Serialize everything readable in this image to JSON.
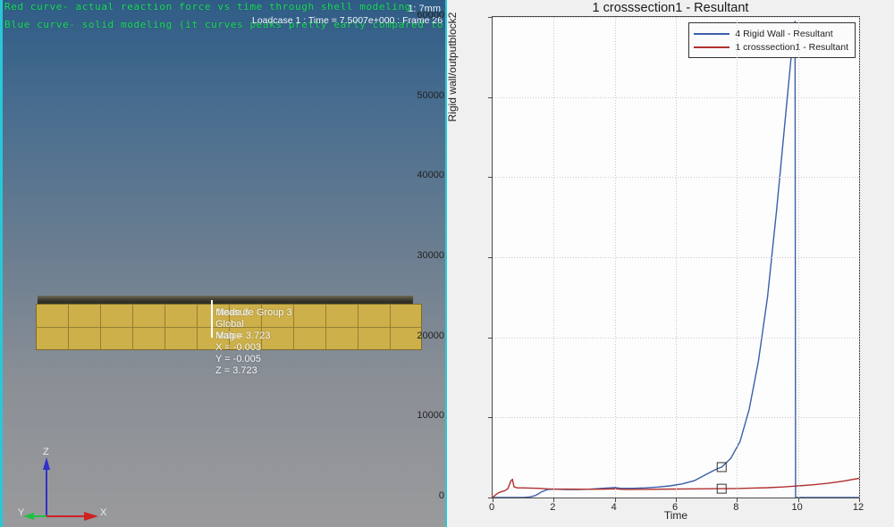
{
  "viewport": {
    "annotation_line1": "Red curve- actual reaction force vs time through shell modeling",
    "annotation_line2": "Blue curve- solid modeling (it curves peaks pretty early compared to the red curve which shouldn't happen)",
    "view_scale_label": "1: 7mm",
    "loadcase_status": "Loadcase 1 : Time = 7.5007e+000 : Frame 26",
    "measure": {
      "group_label": "Measure Group 3",
      "overlay_label": "Node 3",
      "frame_label": "Global",
      "mag_label": "Mag = 3.723",
      "mag_overlay": "Value",
      "x_label": "X = -0.003",
      "y_label": "Y = -0.005",
      "z_label": "Z = 3.723"
    },
    "triad": {
      "x_axis": "X",
      "y_axis": "Y",
      "z_axis": "Z"
    },
    "colors": {
      "annotation_green": "#19e05a",
      "border_cyan": "#28c8d8",
      "mesh_gold": "#cdb04a",
      "axis_x_red": "#d02020",
      "axis_y_green": "#20c040",
      "axis_z_blue": "#3030c8"
    },
    "mesh": {
      "columns": 12,
      "rows": 2
    }
  },
  "chart_data": {
    "type": "line",
    "title": "1 crosssection1 - Resultant",
    "xlabel": "Time",
    "ylabel": "Rigid wall/outputblock2",
    "xlim": [
      0,
      12
    ],
    "ylim": [
      0,
      60000
    ],
    "xticks": [
      0,
      2,
      4,
      6,
      8,
      10,
      12
    ],
    "xtick_labels": [
      "0",
      "2",
      "4",
      "6",
      "8",
      "10",
      "12"
    ],
    "yticks": [
      0,
      10000,
      20000,
      30000,
      40000,
      50000,
      60000
    ],
    "ytick_labels": [
      "0",
      "10000",
      "20000",
      "30000",
      "40000",
      "50000",
      "60000"
    ],
    "grid": true,
    "legend_position": "top-right",
    "series": [
      {
        "name": "4 Rigid Wall - Resultant",
        "color": "#3b5fa8",
        "marker_point": {
          "x": 7.5,
          "y": 3800
        },
        "x": [
          0,
          0.2,
          0.5,
          0.8,
          1.0,
          1.2,
          1.4,
          1.6,
          1.8,
          2.0,
          2.4,
          2.8,
          3.2,
          3.6,
          4.0,
          4.2,
          4.6,
          5.0,
          5.4,
          5.8,
          6.2,
          6.6,
          7.0,
          7.3,
          7.5,
          7.8,
          8.1,
          8.4,
          8.7,
          9.0,
          9.3,
          9.6,
          9.85,
          9.9,
          9.92,
          12.0
        ],
        "y": [
          0,
          0,
          0,
          0,
          0,
          60,
          240,
          700,
          1000,
          1050,
          1000,
          1000,
          1050,
          1150,
          1250,
          1150,
          1150,
          1200,
          1300,
          1450,
          1700,
          2100,
          2900,
          3500,
          3800,
          4900,
          7000,
          11000,
          17000,
          25000,
          36000,
          48000,
          58000,
          59500,
          0,
          0
        ]
      },
      {
        "name": "1 crosssection1 - Resultant",
        "color": "#b03030",
        "marker_point": {
          "x": 7.5,
          "y": 1100
        },
        "x": [
          0,
          0.1,
          0.2,
          0.3,
          0.4,
          0.5,
          0.6,
          0.65,
          0.7,
          0.8,
          0.9,
          1.0,
          1.2,
          1.5,
          1.8,
          2.0,
          2.5,
          3.0,
          3.5,
          4.0,
          4.3,
          5.0,
          6.0,
          7.0,
          7.5,
          8.0,
          8.5,
          9.0,
          9.5,
          10.0,
          10.5,
          11.0,
          11.5,
          12.0
        ],
        "y": [
          0,
          350,
          600,
          750,
          850,
          1100,
          2100,
          2250,
          1350,
          1200,
          1200,
          1200,
          1180,
          1150,
          1080,
          1060,
          1050,
          1040,
          1040,
          1080,
          1020,
          1030,
          1060,
          1090,
          1100,
          1130,
          1180,
          1230,
          1320,
          1450,
          1600,
          1800,
          2050,
          2400
        ]
      }
    ]
  }
}
